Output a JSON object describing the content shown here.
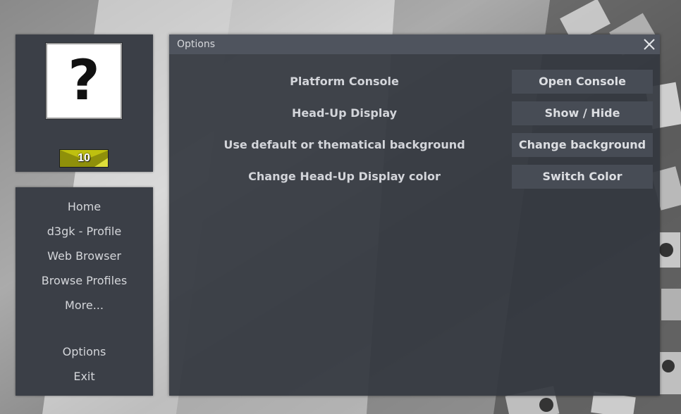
{
  "profile": {
    "avatar_glyph": "?",
    "level": "10",
    "badge_color": "#bfc00f"
  },
  "nav": {
    "items": [
      {
        "label": "Home"
      },
      {
        "label": "d3gk - Profile"
      },
      {
        "label": "Web Browser"
      },
      {
        "label": "Browse Profiles"
      },
      {
        "label": "More..."
      },
      {
        "label": "Options"
      },
      {
        "label": "Exit"
      }
    ]
  },
  "options_window": {
    "title": "Options",
    "close_icon": "close-icon",
    "rows": [
      {
        "label": "Platform Console",
        "button": "Open Console"
      },
      {
        "label": "Head-Up Display",
        "button": "Show / Hide"
      },
      {
        "label": "Use default or thematical background",
        "button": "Change background"
      },
      {
        "label": "Change Head-Up Display color",
        "button": "Switch Color"
      }
    ]
  },
  "colors": {
    "panel": "#3b3f47",
    "titlebar": "#4f545e",
    "button": "#474c55",
    "text": "#d4d6da"
  }
}
